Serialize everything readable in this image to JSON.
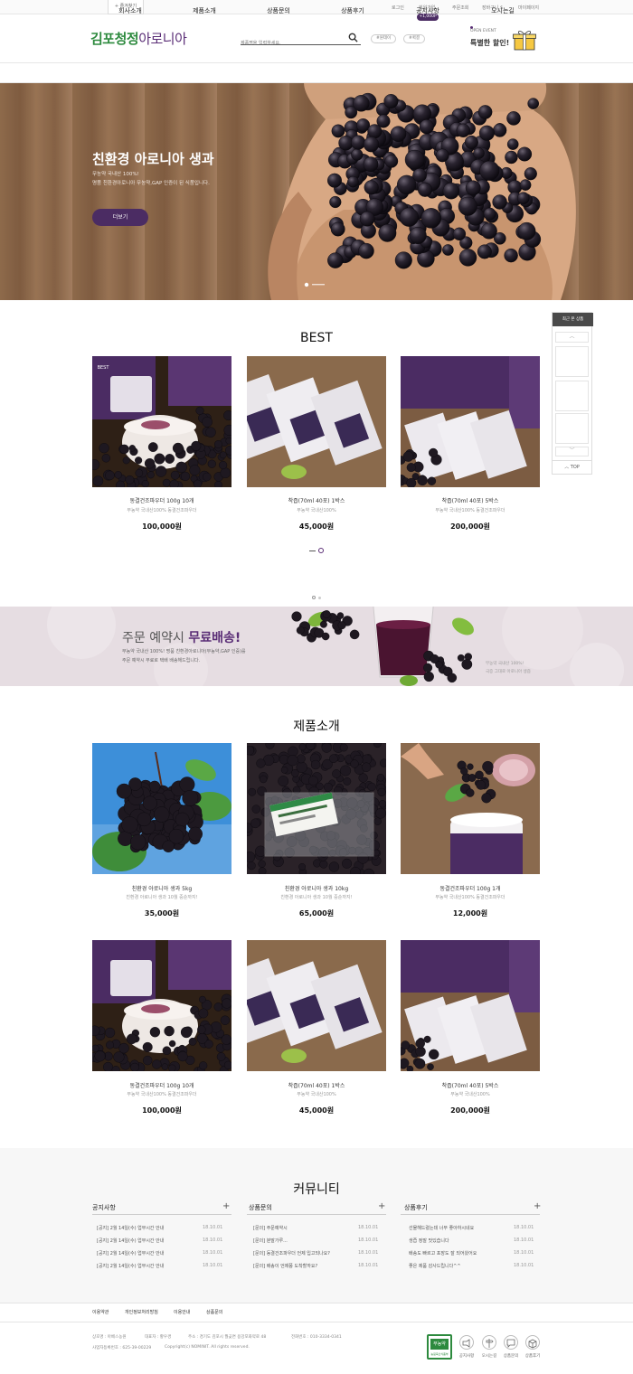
{
  "topbar": {
    "bookmark": "+ 즐겨찾기",
    "links": [
      "로그인",
      "회원가입",
      "주문조회",
      "장바구니 $",
      "마이페이지"
    ],
    "point_badge": "+1,000P"
  },
  "header": {
    "logo_green": "김포청정",
    "logo_purple": "아로니아",
    "search_placeholder": "제품명을 입력하세요.",
    "tags": [
      "#원데이",
      "#퀵결"
    ],
    "event_small": "OPEN EVENT",
    "event_big": "특별한 할인!"
  },
  "nav": [
    "회사소개",
    "제품소개",
    "상품문의",
    "상품후기",
    "공지사항",
    "오시는길"
  ],
  "hero": {
    "title": "친환경 아로니아 생과",
    "sub1": "무농약 국내산 100%!",
    "sub2": "명품 친환경아로니아 무농약,GAP 인증이 된 식품입니다.",
    "button": "더보기"
  },
  "recent": {
    "title": "최근 본 상품",
    "top": "TOP"
  },
  "best": {
    "title": "BEST",
    "badge": "BEST",
    "items": [
      {
        "name": "동결건조파우더 100g 10개",
        "desc": "무농약 국내산100% 동결건조파우더",
        "price": "100,000원"
      },
      {
        "name": "착즙(70ml 40포) 1박스",
        "desc": "무농약 국내산100%",
        "price": "45,000원"
      },
      {
        "name": "착즙(70ml 40포) 5박스",
        "desc": "무농약 국내산100% 동결건조파우더",
        "price": "200,000원"
      }
    ]
  },
  "promo": {
    "title_plain": "주문 예약시 ",
    "title_bold": "무료배송!",
    "sub1": "무농약 국내산 100%! 명품 친환경아로니아(무농약,GAP 인증)를",
    "sub2": "주문 예약시 무료로 택배 배송해드립니다.",
    "right1": "무농약 국내산 100%!",
    "right2": "극증 그대로 아로니아 생즙"
  },
  "products": {
    "title": "제품소개",
    "items": [
      {
        "name": "친환경 아로니아 생과 5kg",
        "desc": "친환경 아로니아 생과 10월 중순까지!",
        "price": "35,000원"
      },
      {
        "name": "친환경 아로니아 생과 10kg",
        "desc": "친환경 아로니아 생과 10월 중순까지!",
        "price": "65,000원"
      },
      {
        "name": "동결건조파우더 100g 1개",
        "desc": "무농약 국내산100% 동결건조파우더",
        "price": "12,000원"
      },
      {
        "name": "동결건조파우더 100g 10개",
        "desc": "무농약 국내산100% 동결건조파우더",
        "price": "100,000원"
      },
      {
        "name": "착즙(70ml 40포) 1박스",
        "desc": "무농약 국내산100%",
        "price": "45,000원"
      },
      {
        "name": "착즙(70ml 40포) 5박스",
        "desc": "무농약 국내산100%",
        "price": "200,000원"
      }
    ]
  },
  "community": {
    "title": "커뮤니티",
    "columns": [
      {
        "head": "공지사항",
        "items": [
          {
            "text": "[공지] 2월 14일(수) 업무시간 안내",
            "date": "18.10.01"
          },
          {
            "text": "[공지] 2월 14일(수) 업무시간 안내",
            "date": "18.10.01"
          },
          {
            "text": "[공지] 2월 14일(수) 업무시간 안내",
            "date": "18.10.01"
          },
          {
            "text": "[공지] 2월 14일(수) 업무시간 안내",
            "date": "18.10.01"
          }
        ]
      },
      {
        "head": "상품문의",
        "items": [
          {
            "text": "[문의] 주문예약시",
            "date": "18.10.01"
          },
          {
            "text": "[문의] 분말가루...",
            "date": "18.10.01"
          },
          {
            "text": "[문의] 동결건조파우더 언제 입고되나요?",
            "date": "18.10.01"
          },
          {
            "text": "[문의] 배송이 언제쯤 도착할까요?",
            "date": "18.10.01"
          }
        ]
      },
      {
        "head": "상품후기",
        "items": [
          {
            "text": "선물해드렸는데 너무 좋아하시네요",
            "date": "18.10.01"
          },
          {
            "text": "생즙 정말 맛있습니다",
            "date": "18.10.01"
          },
          {
            "text": "배송도 빠르고 포장도 잘 되어왔어요",
            "date": "18.10.01"
          },
          {
            "text": "좋은 제품 감사드립니다^^",
            "date": "18.10.01"
          }
        ]
      }
    ]
  },
  "footer": {
    "links": [
      "이용약관",
      "개인정보처리방침",
      "이용안내",
      "상품문의"
    ],
    "info1": "상호명 : 아베스농원",
    "info2": "대표자 : 황우경",
    "info3": "주소 : 경기도 김포시 월곶면 용강포화약로 48",
    "info4": "전화번호 : 010-3334-0341",
    "info5": "사업자등록번호 : 625-39-00229",
    "info6": "Copyright(c) NOMINIT. All rights reserved.",
    "cert_top": "무농약",
    "cert_bottom": "농림축산식품부",
    "icons": [
      "공지사항",
      "오시는길",
      "상품문의",
      "상품후기"
    ]
  }
}
